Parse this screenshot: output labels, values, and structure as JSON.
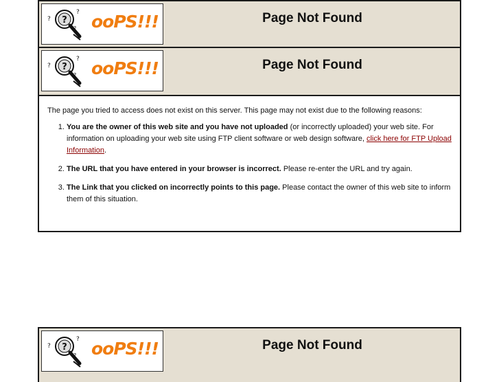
{
  "header": {
    "logo_text": "ooPS!!!",
    "title": "Page Not Found"
  },
  "message": {
    "intro": "The page you tried to access does not exist on this server. This page may not exist due to the following reasons:",
    "reasons": [
      {
        "bold": "You are the owner of this web site and you have not uploaded",
        "text": " (or incorrectly uploaded) your web site. For information on uploading your web site using FTP client software or web design software, ",
        "link": "click here for FTP Upload Information",
        "after": "."
      },
      {
        "bold": "The URL that you have entered in your browser is incorrect.",
        "text": " Please re-enter the URL and try again."
      },
      {
        "bold": "The Link that you clicked on incorrectly points to this page.",
        "text": " Please contact the owner of this web site to inform them of this situation."
      }
    ]
  },
  "colors": {
    "header_bg": "#e5dfd2",
    "logo_orange": "#f07d10",
    "link": "#8b0000"
  }
}
